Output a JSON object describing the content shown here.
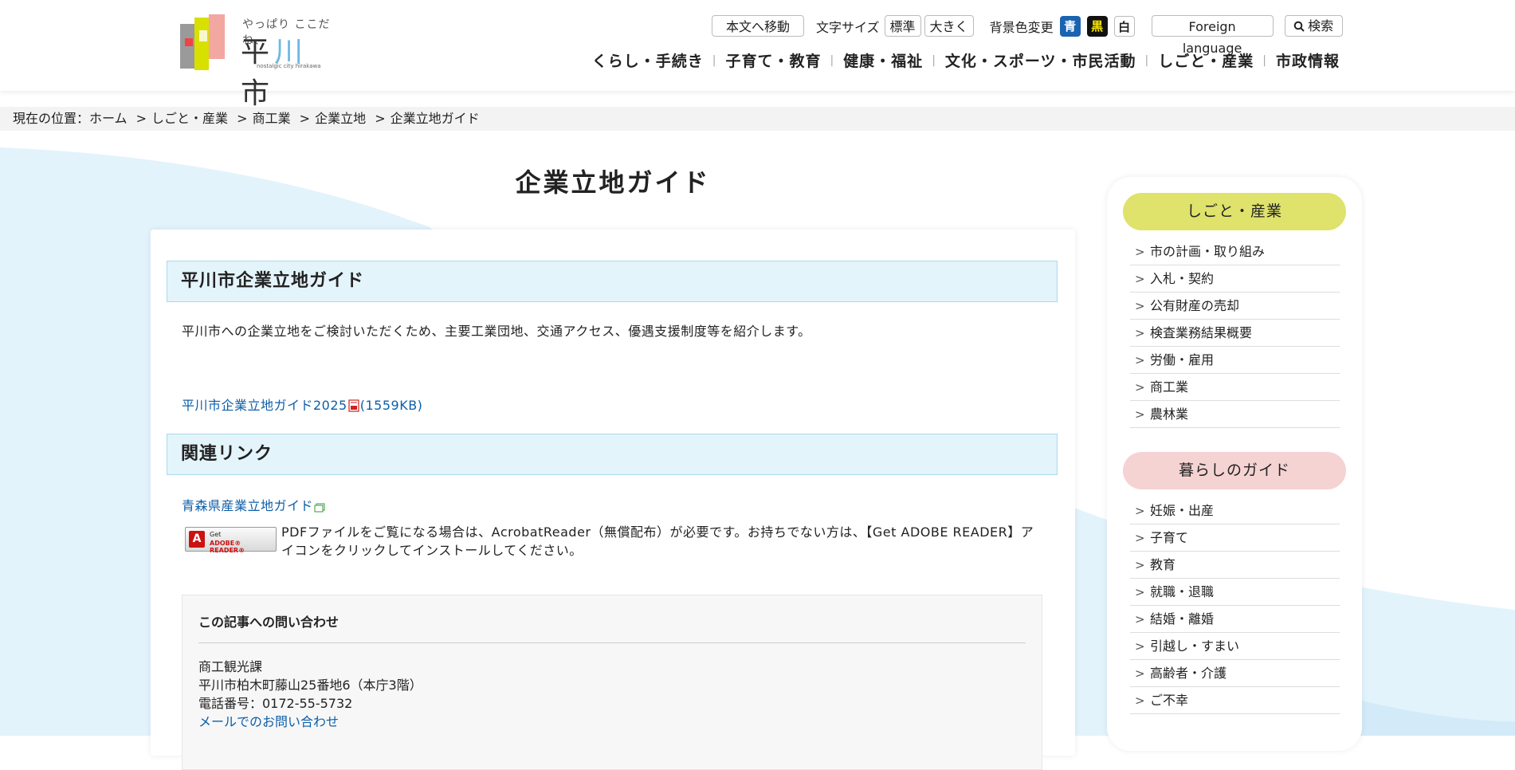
{
  "header": {
    "logo": {
      "tagline": "やっぱり ここだね、",
      "name_pre": "平",
      "name_accent": "川",
      "name_post": "市",
      "subtitle": "nostalgic city hirakawa"
    },
    "skip_label": "本文へ移動",
    "font_size_label": "文字サイズ",
    "font_standard": "標準",
    "font_large": "大きく",
    "bg_color_label": "背景色変更",
    "bg_blue": "青",
    "bg_black": "黒",
    "bg_white": "白",
    "foreign_label": "Foreign language",
    "search_label": "検索",
    "nav": [
      "くらし・手続き",
      "子育て・教育",
      "健康・福祉",
      "文化・スポーツ・市民活動",
      "しごと・産業",
      "市政情報"
    ]
  },
  "breadcrumb": {
    "prefix": "現在の位置：",
    "items": [
      "ホーム",
      "しごと・産業",
      "商工業",
      "企業立地",
      "企業立地ガイド"
    ],
    "separator": ">"
  },
  "page_title": "企業立地ガイド",
  "main": {
    "section1_heading": "平川市企業立地ガイド",
    "intro": "平川市への企業立地をご検討いただくため、主要工業団地、交通アクセス、優遇支援制度等を紹介します。",
    "pdf_link_text": "平川市企業立地ガイド2025",
    "pdf_size": "(1559KB)",
    "section2_heading": "関連リンク",
    "related_link": "青森県産業立地ガイド",
    "adobe_badge_line1": "Get",
    "adobe_badge_line2": "ADOBE® READER®",
    "adobe_note": "PDFファイルをご覧になる場合は、AcrobatReader（無償配布）が必要です。お持ちでない方は、【Get ADOBE READER】アイコンをクリックしてインストールしてください。",
    "contact": {
      "heading": "この記事への問い合わせ",
      "dept": "商工観光課",
      "address": "平川市柏木町藤山25番地6（本庁3階）",
      "phone": "電話番号：0172-55-5732",
      "mail_link": "メールでのお問い合わせ"
    }
  },
  "sidebar": {
    "group1_title": "しごと・産業",
    "group1_color": "#dfe26b",
    "group1_items": [
      "市の計画・取り組み",
      "入札・契約",
      "公有財産の売却",
      "検査業務結果概要",
      "労働・雇用",
      "商工業",
      "農林業"
    ],
    "group2_title": "暮らしのガイド",
    "group2_color": "#f5d3d3",
    "group2_items": [
      "妊娠・出産",
      "子育て",
      "教育",
      "就職・退職",
      "結婚・離婚",
      "引越し・すまい",
      "高齢者・介護",
      "ご不幸"
    ]
  },
  "colors": {
    "link": "#0d5ea8",
    "heading_bg": "#e4f4fb",
    "bg_wave": "#e3f3fc",
    "blue_btn": "#1a63b0",
    "black_btn": "#111111",
    "black_btn_text": "#f7e600"
  }
}
